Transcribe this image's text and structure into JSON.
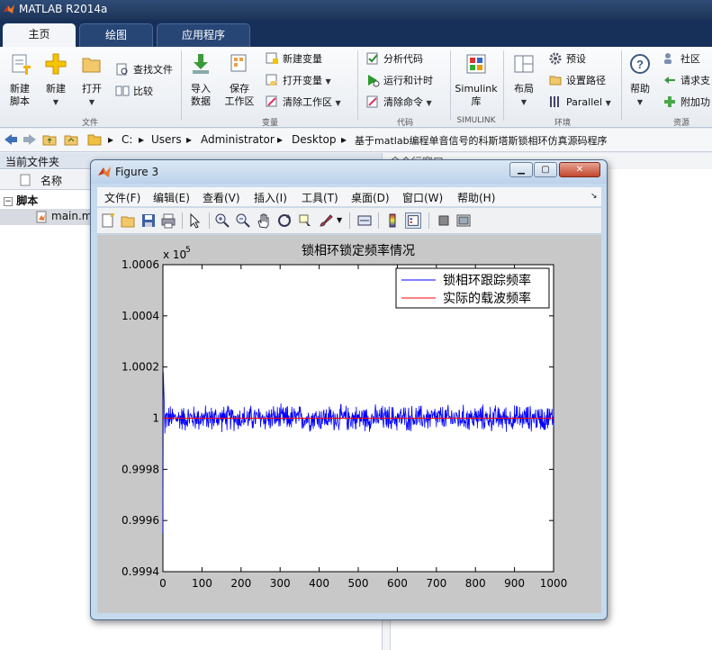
{
  "app": {
    "title": "MATLAB R2014a"
  },
  "tabs": [
    {
      "label": "主页",
      "active": true
    },
    {
      "label": "绘图",
      "active": false
    },
    {
      "label": "应用程序",
      "active": false
    }
  ],
  "ribbon": {
    "new_script": "新建\n脚本",
    "new": "新建",
    "open": "打开",
    "find_files": "查找文件",
    "compare": "比较",
    "group_file": "文件",
    "import_data": "导入\n数据",
    "save_workspace": "保存\n工作区",
    "new_variable": "新建变量",
    "open_variable": "打开变量",
    "clear_workspace": "清除工作区",
    "group_variable": "变量",
    "analyze_code": "分析代码",
    "run_and_time": "运行和计时",
    "clear_commands": "清除命令",
    "group_code": "代码",
    "simulink_library": "Simulink\n库",
    "group_simulink": "SIMULINK",
    "layout": "布局",
    "preferences": "预设",
    "set_path": "设置路径",
    "parallel": "Parallel",
    "group_environment": "环境",
    "help": "帮助",
    "community": "社区",
    "request_support": "请求支",
    "addons": "附加功",
    "group_resources": "资源"
  },
  "path": {
    "segments": [
      "C:",
      "Users",
      "Administrator",
      "Desktop",
      "基于matlab编程单音信号的科斯塔斯锁相环仿真源码程序"
    ]
  },
  "current_folder": {
    "title": "当前文件夹",
    "column_name": "名称",
    "folder": "脚本",
    "file": "main.m"
  },
  "command_window": {
    "title": "命令行窗口"
  },
  "figure": {
    "title": "Figure 3",
    "menus": [
      "文件(F)",
      "编辑(E)",
      "查看(V)",
      "插入(I)",
      "工具(T)",
      "桌面(D)",
      "窗口(W)",
      "帮助(H)"
    ]
  },
  "chart_data": {
    "type": "line",
    "title": "锁相环锁定频率情况",
    "xlabel": "",
    "ylabel": "",
    "y_exponent_label": "x 10",
    "y_exponent": "5",
    "xlim": [
      0,
      1000
    ],
    "ylim": [
      0.9994,
      1.0006
    ],
    "xticks": [
      "0",
      "100",
      "200",
      "300",
      "400",
      "500",
      "600",
      "700",
      "800",
      "900",
      "1000"
    ],
    "yticks": [
      "0.9994",
      "0.9996",
      "0.9998",
      "1",
      "1.0002",
      "1.0004",
      "1.0006"
    ],
    "legend_position": "top-right",
    "series": [
      {
        "name": "锁相环跟踪频率",
        "color": "#0000ff",
        "description": "noisy tracking frequency around 1.0000 (x1e5), initial transient: spike to ~1.00018 at start then dip to ~0.99955, then fluctuation approx ±0.00006",
        "transient": [
          [
            0,
            0.99955
          ],
          [
            1,
            1.00018
          ],
          [
            3,
            1.00008
          ],
          [
            5,
            0.99994
          ]
        ],
        "noise_amplitude": 6e-05,
        "n_points": 1000
      },
      {
        "name": "实际的载波频率",
        "color": "#ff0000",
        "x": [
          0,
          1000
        ],
        "y": [
          1.0,
          1.0
        ]
      }
    ]
  }
}
